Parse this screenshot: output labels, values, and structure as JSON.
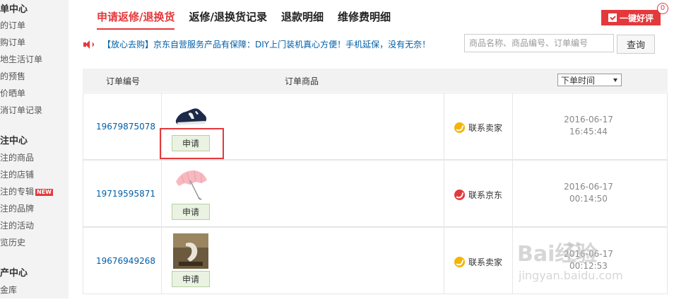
{
  "sidebar": {
    "sections": [
      {
        "title": "单中心",
        "items": [
          {
            "label": "的订单"
          },
          {
            "label": "购订单"
          },
          {
            "label": "地生活订单"
          },
          {
            "label": "的预售"
          },
          {
            "label": "价晒单"
          },
          {
            "label": "消订单记录"
          }
        ]
      },
      {
        "title": "注中心",
        "items": [
          {
            "label": "注的商品"
          },
          {
            "label": "注的店铺"
          },
          {
            "label": "注的专辑",
            "badge": "NEW"
          },
          {
            "label": "注的品牌"
          },
          {
            "label": "注的活动"
          },
          {
            "label": "览历史"
          }
        ]
      },
      {
        "title": "产中心",
        "items": [
          {
            "label": "金库"
          }
        ]
      }
    ]
  },
  "tabs": [
    {
      "label": "申请返修/退换货",
      "active": true
    },
    {
      "label": "返修/退换货记录",
      "active": false
    },
    {
      "label": "退款明细",
      "active": false
    },
    {
      "label": "维修费明细",
      "active": false
    }
  ],
  "review_button": {
    "label": "一键好评",
    "count": "0"
  },
  "notice": {
    "text": "【放心去购】京东自营服务产品有保障：DIY上门装机真心方便！手机延保，没有无奈！"
  },
  "search": {
    "placeholder": "商品名称、商品编号、订单编号",
    "button": "查询"
  },
  "table": {
    "headers": {
      "order_no": "订单编号",
      "goods": "订单商品",
      "sort_selected": "下单时间"
    },
    "rows": [
      {
        "order_id": "19679875078",
        "apply": "申请",
        "contact": "联系卖家",
        "contact_color": "#f5b400",
        "date": "2016-06-17",
        "time": "16:45:44",
        "thumb": "shoe"
      },
      {
        "order_id": "19719595871",
        "apply": "申请",
        "contact": "联系京东",
        "contact_color": "#e4393c",
        "date": "2016-06-17",
        "time": "00:14:50",
        "thumb": "umbrella"
      },
      {
        "order_id": "19676949268",
        "apply": "申请",
        "contact": "联系卖家",
        "contact_color": "#f5b400",
        "date": "2016-06-17",
        "time": "00:12:53",
        "thumb": "lamp"
      }
    ]
  },
  "watermark": {
    "brand": "Bai经验",
    "url": "jingyan.baidu.com"
  },
  "colors": {
    "accent": "#e4393c",
    "link": "#005ea7"
  }
}
